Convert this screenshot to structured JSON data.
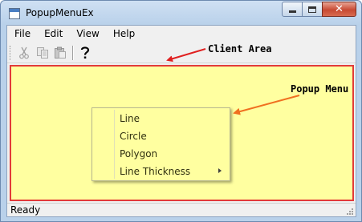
{
  "window": {
    "title": "PopupMenuEx",
    "icon": "app-window-icon"
  },
  "caption_buttons": {
    "minimize_icon": "minimize-icon",
    "maximize_icon": "maximize-icon",
    "close_icon": "close-icon",
    "close_glyph": "✕"
  },
  "menubar": {
    "items": [
      "File",
      "Edit",
      "View",
      "Help"
    ]
  },
  "toolbar": {
    "buttons": [
      {
        "icon": "cut-icon",
        "enabled": false
      },
      {
        "icon": "copy-icon",
        "enabled": false
      },
      {
        "icon": "paste-icon",
        "enabled": false
      },
      {
        "icon": "help-icon",
        "enabled": true,
        "glyph": "?"
      }
    ]
  },
  "client_area": {
    "background": "#ffffa0",
    "border_color": "#e23a3a"
  },
  "popup_menu": {
    "items": [
      {
        "label": "Line",
        "submenu": false
      },
      {
        "label": "Circle",
        "submenu": false
      },
      {
        "label": "Polygon",
        "submenu": false
      },
      {
        "label": "Line Thickness",
        "submenu": true
      }
    ]
  },
  "annotations": {
    "client_area_label": "Client Area",
    "popup_menu_label": "Popup Menu",
    "arrow_red": "#e02020",
    "arrow_orange": "#f07020"
  },
  "statusbar": {
    "text": "Ready"
  }
}
